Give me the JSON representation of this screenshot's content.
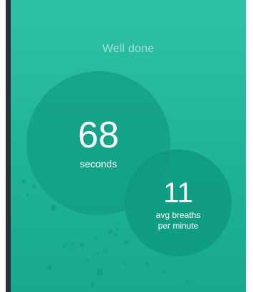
{
  "header": {
    "title": "Well done"
  },
  "stats": {
    "duration": {
      "value": "68",
      "unit": "seconds"
    },
    "breaths": {
      "value": "11",
      "unit_line1": "avg breaths",
      "unit_line2": "per minute"
    }
  },
  "colors": {
    "background": "#1fb39a",
    "circle": "#129e84",
    "text": "#ffffff"
  }
}
